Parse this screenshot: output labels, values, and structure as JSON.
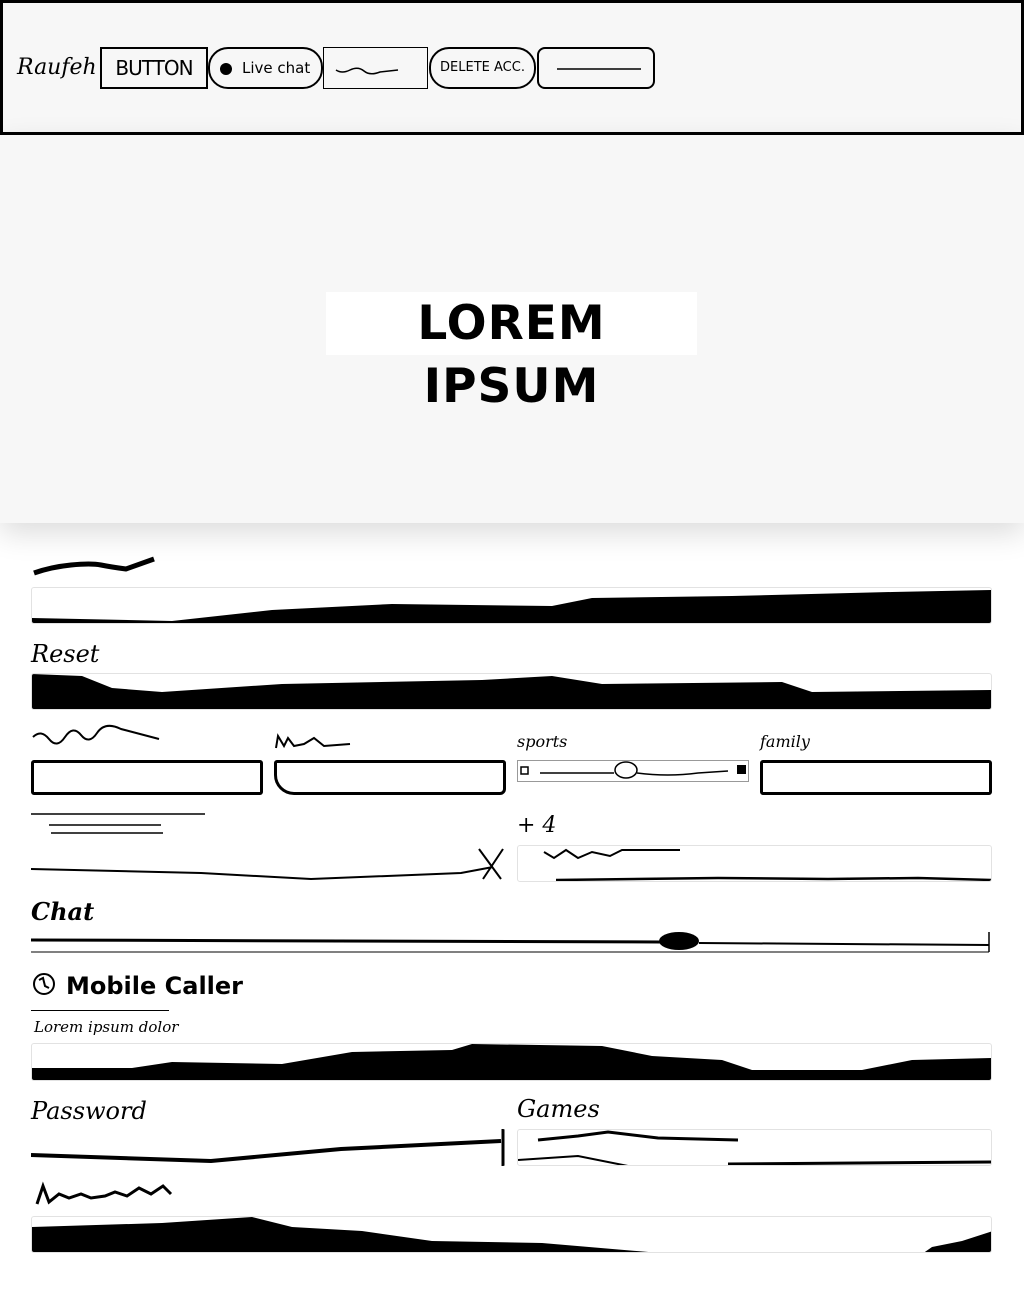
{
  "navbar": {
    "brand": "Raufeh",
    "button_label": "BUTTON",
    "live_chat_label": "Live chat",
    "delete_label": "DELETE ACC."
  },
  "hero": {
    "title": "LOREM IPSUM"
  },
  "form": {
    "reset_label": "Reset",
    "sports_label": "sports",
    "family_label": "family",
    "counter_label": "+ 4",
    "chat_label": "Chat",
    "mobile_caller_label": "Mobile Caller",
    "lorem_label": "Lorem ipsum dolor",
    "password_label": "Password",
    "games_label": "Games"
  },
  "icons": {
    "chat": "speech-bubble-icon",
    "phone": "phone-icon",
    "slider_min": "minus-icon",
    "slider_max": "plus-icon"
  }
}
